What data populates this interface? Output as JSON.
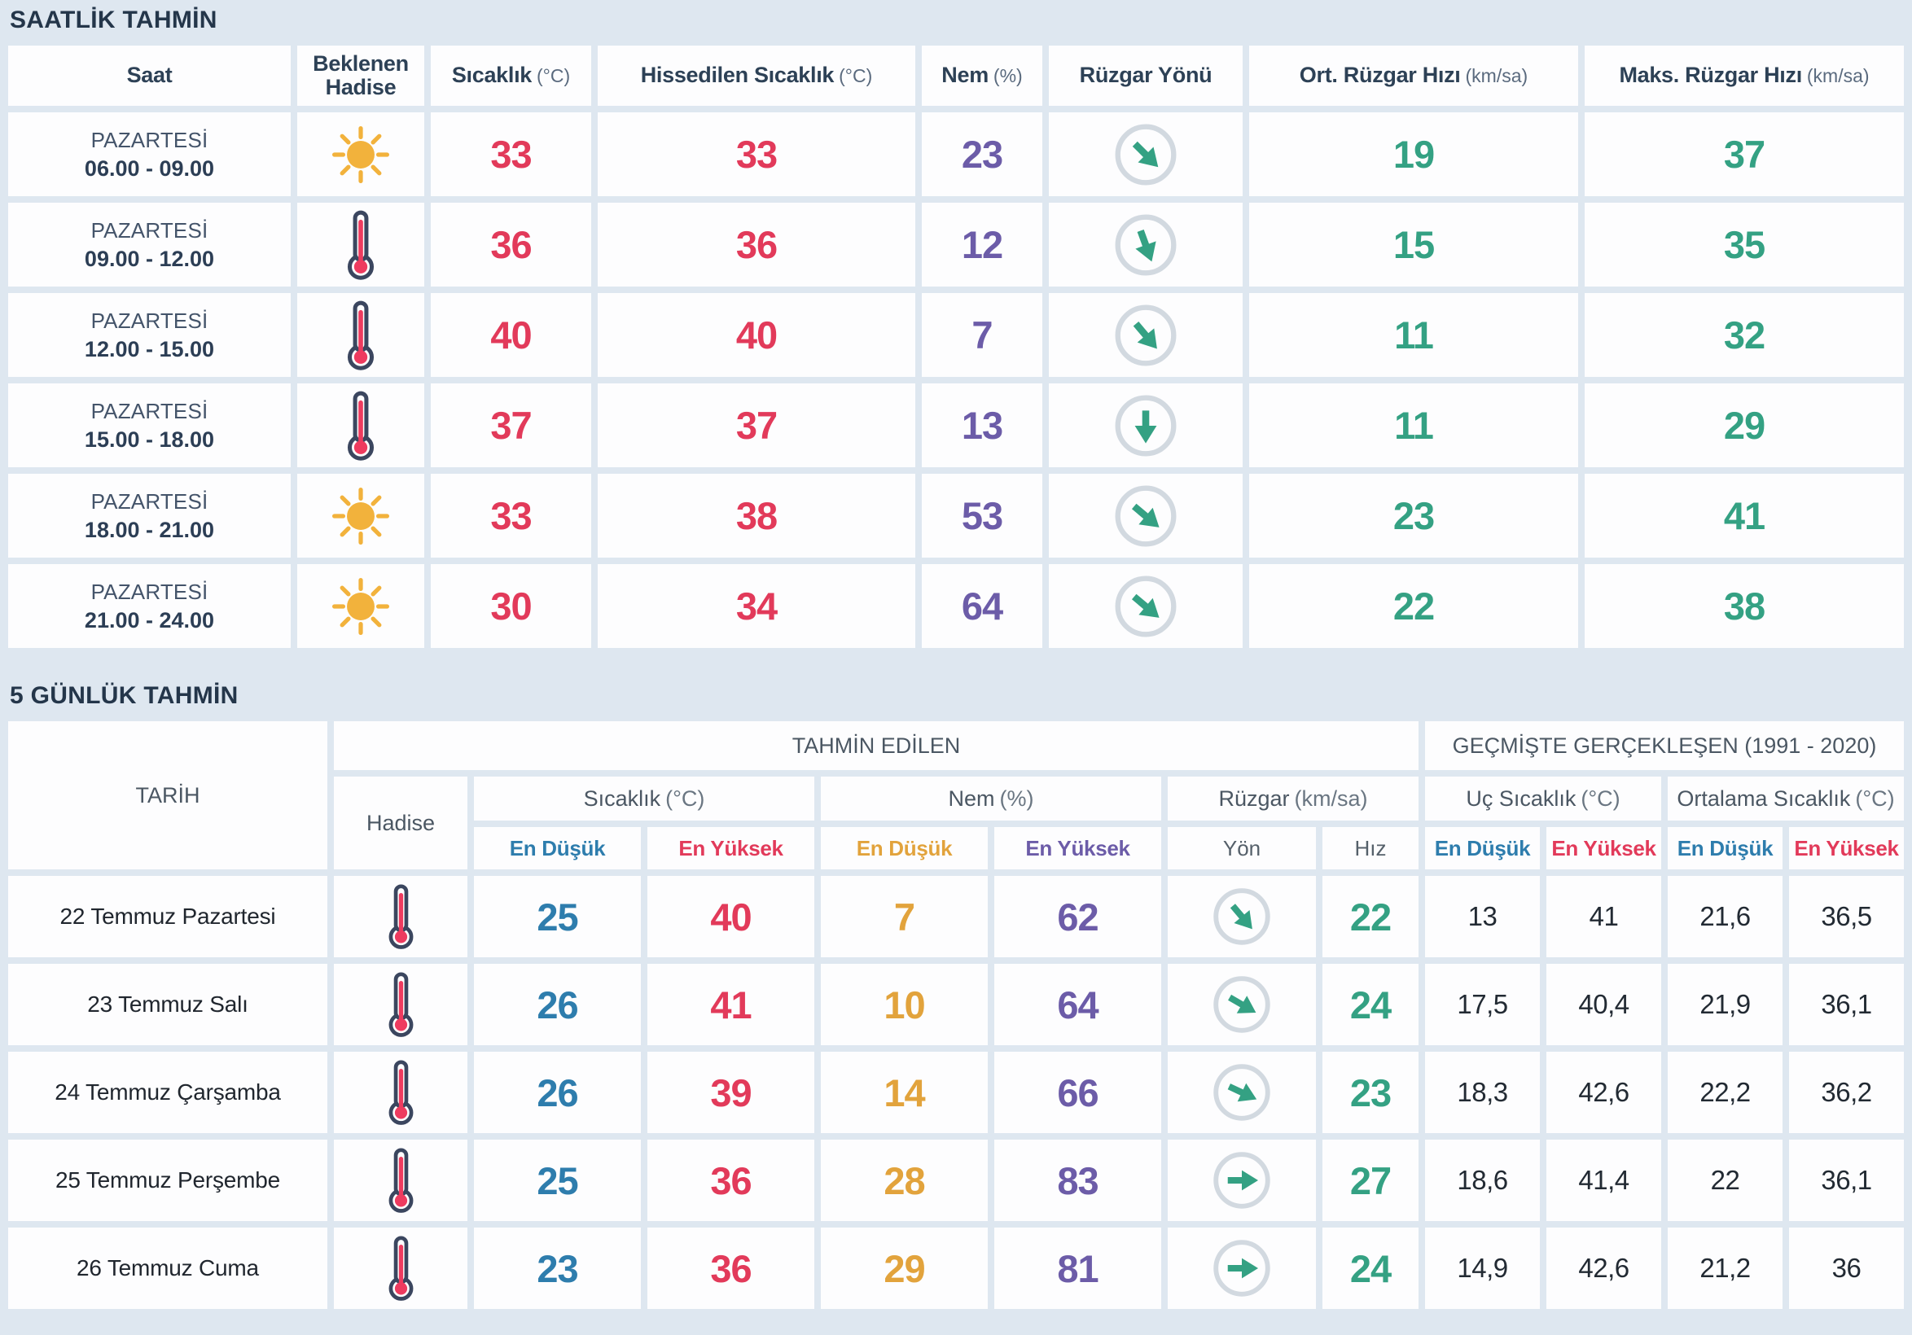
{
  "page": {
    "title_hourly": "SAATLİK TAHMİN",
    "title_daily": "5 GÜNLÜK TAHMİN"
  },
  "colors": {
    "background": "#dee7f0",
    "cell": "#fdfdfe",
    "header_navy": "#2d4156",
    "header_gray": "#4b5763",
    "temp_red": "#e23a5a",
    "min_blue": "#2e7dad",
    "humidity_low_orange": "#e2a33c",
    "humidity_purple": "#6c5ca8",
    "wind_teal": "#34a183",
    "sun_yellow": "#f2b23c",
    "thermometer_outline": "#3b465f",
    "wind_circle_gray": "#d2d9e0"
  },
  "hourly": {
    "columns": {
      "time": "Saat",
      "condition": "Beklenen Hadise",
      "temp": {
        "label": "Sıcaklık",
        "unit": "(°C)"
      },
      "feels": {
        "label": "Hissedilen Sıcaklık",
        "unit": "(°C)"
      },
      "humidity": {
        "label": "Nem",
        "unit": "(%)"
      },
      "wind_dir": "Rüzgar Yönü",
      "avg_wind": {
        "label": "Ort. Rüzgar Hızı",
        "unit": "(km/sa)"
      },
      "max_wind": {
        "label": "Maks. Rüzgar Hızı",
        "unit": "(km/sa)"
      }
    },
    "rows": [
      {
        "day": "PAZARTESİ",
        "time": "06.00 - 09.00",
        "condition_icon": "sunny",
        "temp": "33",
        "feels": "33",
        "humidity": "23",
        "wind_deg": 135,
        "avg_wind": "19",
        "max_wind": "37"
      },
      {
        "day": "PAZARTESİ",
        "time": "09.00 - 12.00",
        "condition_icon": "hot-thermometer",
        "temp": "36",
        "feels": "36",
        "humidity": "12",
        "wind_deg": 160,
        "avg_wind": "15",
        "max_wind": "35"
      },
      {
        "day": "PAZARTESİ",
        "time": "12.00 - 15.00",
        "condition_icon": "hot-thermometer",
        "temp": "40",
        "feels": "40",
        "humidity": "7",
        "wind_deg": 140,
        "avg_wind": "11",
        "max_wind": "32"
      },
      {
        "day": "PAZARTESİ",
        "time": "15.00 - 18.00",
        "condition_icon": "hot-thermometer",
        "temp": "37",
        "feels": "37",
        "humidity": "13",
        "wind_deg": 180,
        "avg_wind": "11",
        "max_wind": "29"
      },
      {
        "day": "PAZARTESİ",
        "time": "18.00 - 21.00",
        "condition_icon": "sunny",
        "temp": "33",
        "feels": "38",
        "humidity": "53",
        "wind_deg": 130,
        "avg_wind": "23",
        "max_wind": "41"
      },
      {
        "day": "PAZARTESİ",
        "time": "21.00 - 24.00",
        "condition_icon": "sunny",
        "temp": "30",
        "feels": "34",
        "humidity": "64",
        "wind_deg": 130,
        "avg_wind": "22",
        "max_wind": "38"
      }
    ]
  },
  "daily": {
    "groups": {
      "forecast": "TAHMİN EDİLEN",
      "historical": "GEÇMİŞTE GERÇEKLEŞEN (1991 - 2020)"
    },
    "columns": {
      "date": "TARİH",
      "condition": "Hadise",
      "temp": {
        "label": "Sıcaklık",
        "unit": "(°C)"
      },
      "humidity": {
        "label": "Nem",
        "unit": "(%)"
      },
      "wind": {
        "label": "Rüzgar",
        "unit": "(km/sa)"
      },
      "extreme": {
        "label": "Uç Sıcaklık",
        "unit": "(°C)"
      },
      "average": {
        "label": "Ortalama Sıcaklık",
        "unit": "(°C)"
      },
      "min": "En Düşük",
      "max": "En Yüksek",
      "dir": "Yön",
      "speed": "Hız"
    },
    "rows": [
      {
        "date": "22 Temmuz Pazartesi",
        "condition_icon": "hot-thermometer",
        "temp_min": "25",
        "temp_max": "40",
        "hum_min": "7",
        "hum_max": "62",
        "wind_deg": 140,
        "wind_speed": "22",
        "ext_min": "13",
        "ext_max": "41",
        "avg_min": "21,6",
        "avg_max": "36,5"
      },
      {
        "date": "23 Temmuz Salı",
        "condition_icon": "hot-thermometer",
        "temp_min": "26",
        "temp_max": "41",
        "hum_min": "10",
        "hum_max": "64",
        "wind_deg": 120,
        "wind_speed": "24",
        "ext_min": "17,5",
        "ext_max": "40,4",
        "avg_min": "21,9",
        "avg_max": "36,1"
      },
      {
        "date": "24 Temmuz Çarşamba",
        "condition_icon": "hot-thermometer",
        "temp_min": "26",
        "temp_max": "39",
        "hum_min": "14",
        "hum_max": "66",
        "wind_deg": 115,
        "wind_speed": "23",
        "ext_min": "18,3",
        "ext_max": "42,6",
        "avg_min": "22,2",
        "avg_max": "36,2"
      },
      {
        "date": "25 Temmuz Perşembe",
        "condition_icon": "hot-thermometer",
        "temp_min": "25",
        "temp_max": "36",
        "hum_min": "28",
        "hum_max": "83",
        "wind_deg": 90,
        "wind_speed": "27",
        "ext_min": "18,6",
        "ext_max": "41,4",
        "avg_min": "22",
        "avg_max": "36,1"
      },
      {
        "date": "26 Temmuz Cuma",
        "condition_icon": "hot-thermometer",
        "temp_min": "23",
        "temp_max": "36",
        "hum_min": "29",
        "hum_max": "81",
        "wind_deg": 90,
        "wind_speed": "24",
        "ext_min": "14,9",
        "ext_max": "42,6",
        "avg_min": "21,2",
        "avg_max": "36"
      }
    ]
  }
}
